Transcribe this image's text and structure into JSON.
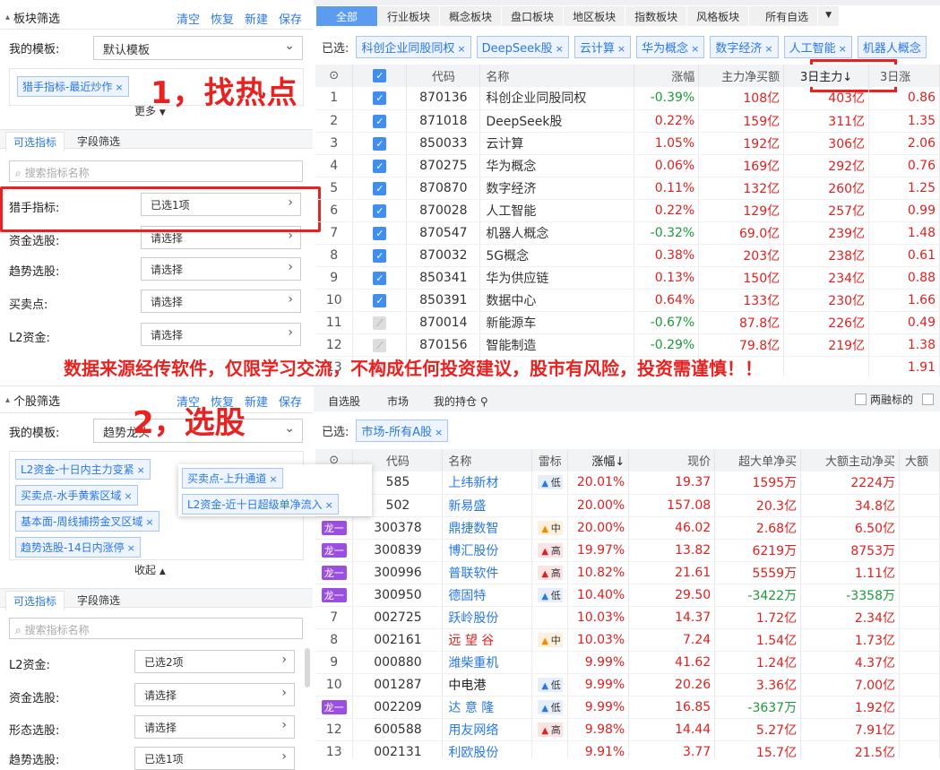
{
  "sector_filter": {
    "title": "板块筛选",
    "links": [
      "清空",
      "恢复",
      "新建",
      "保存"
    ],
    "template_label": "我的模板:",
    "template_value": "默认模板",
    "tag": "猎手指标-最近炒作",
    "more": "更多",
    "subtabs": [
      "可选指标",
      "字段筛选"
    ],
    "search_placeholder": "搜索指标名称",
    "rows": [
      {
        "label": "猎手指标:",
        "value": "已选1项"
      },
      {
        "label": "资金选股:",
        "value": "请选择"
      },
      {
        "label": "趋势选股:",
        "value": "请选择"
      },
      {
        "label": "买卖点:",
        "value": "请选择"
      },
      {
        "label": "L2资金:",
        "value": "请选择"
      }
    ]
  },
  "annotations": {
    "step1": "1，找热点",
    "step2": "2，选股",
    "disclaimer": "数据来源经传软件，仅限学习交流，不构成任何投资建议，股市有风险，投资需谨慎！！"
  },
  "sector_tabs": [
    "全部",
    "行业板块",
    "概念板块",
    "盘口板块",
    "地区板块",
    "指数板块",
    "风格板块",
    "所有自选"
  ],
  "sector_selected": {
    "label": "已选:",
    "chips": [
      "科创企业同股同权",
      "DeepSeek股",
      "云计算",
      "华为概念",
      "数字经济",
      "人工智能",
      "机器人概念"
    ]
  },
  "sector_table": {
    "headers": [
      "",
      "",
      "代码",
      "名称",
      "涨幅",
      "主力净买额",
      "3日主力↓",
      "3日涨"
    ],
    "rows": [
      {
        "n": "1",
        "checked": true,
        "code": "870136",
        "name": "科创企业同股同权",
        "chg": "-0.39%",
        "net": "108亿",
        "d3": "403亿",
        "d3c": "0.86"
      },
      {
        "n": "2",
        "checked": true,
        "code": "871018",
        "name": "DeepSeek股",
        "chg": "0.22%",
        "net": "159亿",
        "d3": "311亿",
        "d3c": "1.35"
      },
      {
        "n": "3",
        "checked": true,
        "code": "850033",
        "name": "云计算",
        "chg": "1.05%",
        "net": "192亿",
        "d3": "306亿",
        "d3c": "2.06"
      },
      {
        "n": "4",
        "checked": true,
        "code": "870275",
        "name": "华为概念",
        "chg": "0.06%",
        "net": "169亿",
        "d3": "292亿",
        "d3c": "0.76"
      },
      {
        "n": "5",
        "checked": true,
        "code": "870870",
        "name": "数字经济",
        "chg": "0.11%",
        "net": "132亿",
        "d3": "260亿",
        "d3c": "1.25"
      },
      {
        "n": "6",
        "checked": true,
        "code": "870028",
        "name": "人工智能",
        "chg": "0.22%",
        "net": "129亿",
        "d3": "257亿",
        "d3c": "0.99"
      },
      {
        "n": "7",
        "checked": true,
        "code": "870547",
        "name": "机器人概念",
        "chg": "-0.32%",
        "net": "69.0亿",
        "d3": "239亿",
        "d3c": "1.48"
      },
      {
        "n": "8",
        "checked": true,
        "code": "870032",
        "name": "5G概念",
        "chg": "0.38%",
        "net": "203亿",
        "d3": "238亿",
        "d3c": "0.61"
      },
      {
        "n": "9",
        "checked": true,
        "code": "850341",
        "name": "华为供应链",
        "chg": "0.13%",
        "net": "150亿",
        "d3": "234亿",
        "d3c": "0.88"
      },
      {
        "n": "10",
        "checked": true,
        "code": "850391",
        "name": "数据中心",
        "chg": "0.64%",
        "net": "133亿",
        "d3": "230亿",
        "d3c": "1.66"
      },
      {
        "n": "11",
        "checked": false,
        "code": "870014",
        "name": "新能源车",
        "chg": "-0.67%",
        "net": "87.8亿",
        "d3": "226亿",
        "d3c": "0.49"
      },
      {
        "n": "12",
        "checked": false,
        "code": "870156",
        "name": "智能制造",
        "chg": "-0.29%",
        "net": "79.8亿",
        "d3": "219亿",
        "d3c": "1.38"
      },
      {
        "n": "13",
        "checked": false,
        "code": "",
        "name": "",
        "chg": "",
        "net": "",
        "d3": "",
        "d3c": "1.91"
      }
    ]
  },
  "stock_filter": {
    "title": "个股筛选",
    "links": [
      "清空",
      "恢复",
      "新建",
      "保存"
    ],
    "template_label": "我的模板:",
    "template_value": "趋势龙头",
    "tags": [
      "L2资金-十日内主力变紧",
      "买卖点-水手黄紫区域",
      "基本面-周线捕捞金叉区域",
      "趋势选股-14日内涨停"
    ],
    "popup_tags": [
      "买卖点-上升通道",
      "L2资金-近十日超级单净流入"
    ],
    "collapse": "收起",
    "subtabs": [
      "可选指标",
      "字段筛选"
    ],
    "search_placeholder": "搜索指标名称",
    "rows": [
      {
        "label": "L2资金:",
        "value": "已选2项"
      },
      {
        "label": "资金选股:",
        "value": "请选择"
      },
      {
        "label": "形态选股:",
        "value": "请选择"
      },
      {
        "label": "趋势选股:",
        "value": "已选1项"
      }
    ]
  },
  "stock_tabs": [
    "自选股",
    "市场",
    "我的持仓"
  ],
  "stock_options": {
    "label": "两融标的"
  },
  "stock_selected": {
    "label": "已选:",
    "chips": [
      "市场-所有A股"
    ]
  },
  "stock_table": {
    "headers": [
      "",
      "代码",
      "名称",
      "雷标",
      "涨幅↓",
      "现价",
      "超大单净买",
      "大额主动净买",
      "大额"
    ],
    "rows": [
      {
        "n": "",
        "badge": "",
        "code": "585",
        "name": "上纬新材",
        "risk": "低",
        "chg": "20.01%",
        "price": "19.37",
        "big": "1595万",
        "act": "2224万"
      },
      {
        "n": "",
        "badge": "",
        "code": "502",
        "name": "新易盛",
        "risk": "",
        "chg": "20.00%",
        "price": "157.08",
        "big": "20.3亿",
        "act": "34.8亿"
      },
      {
        "n": "",
        "badge": "龙一",
        "code": "300378",
        "name": "鼎捷数智",
        "risk": "中",
        "chg": "20.00%",
        "price": "46.02",
        "big": "2.68亿",
        "act": "6.50亿"
      },
      {
        "n": "",
        "badge": "龙一",
        "code": "300839",
        "name": "博汇股份",
        "risk": "高",
        "chg": "19.97%",
        "price": "13.82",
        "big": "6219万",
        "act": "8753万"
      },
      {
        "n": "",
        "badge": "龙一",
        "code": "300996",
        "name": "普联软件",
        "risk": "高",
        "chg": "10.82%",
        "price": "21.61",
        "big": "5559万",
        "act": "1.11亿"
      },
      {
        "n": "",
        "badge": "龙一",
        "code": "300950",
        "name": "德固特",
        "risk": "低",
        "chg": "10.40%",
        "price": "29.50",
        "big": "-3422万",
        "act": "-3358万"
      },
      {
        "n": "7",
        "badge": "",
        "code": "002725",
        "name": "跃岭股份",
        "risk": "",
        "chg": "10.03%",
        "price": "14.37",
        "big": "1.72亿",
        "act": "2.34亿"
      },
      {
        "n": "8",
        "badge": "",
        "code": "002161",
        "name": "远 望 谷",
        "risk": "中",
        "chg": "10.03%",
        "price": "7.24",
        "big": "1.54亿",
        "act": "1.73亿"
      },
      {
        "n": "9",
        "badge": "",
        "code": "000880",
        "name": "潍柴重机",
        "risk": "",
        "chg": "9.99%",
        "price": "41.62",
        "big": "1.24亿",
        "act": "4.37亿"
      },
      {
        "n": "10",
        "badge": "",
        "code": "001287",
        "name": "中电港",
        "risk": "低",
        "chg": "9.99%",
        "price": "20.26",
        "big": "3.36亿",
        "act": "7.00亿"
      },
      {
        "n": "",
        "badge": "龙一",
        "code": "002209",
        "name": "达 意 隆",
        "risk": "低",
        "chg": "9.99%",
        "price": "16.85",
        "big": "-3637万",
        "act": "1.92亿"
      },
      {
        "n": "12",
        "badge": "",
        "code": "600588",
        "name": "用友网络",
        "risk": "高",
        "chg": "9.98%",
        "price": "14.44",
        "big": "5.27亿",
        "act": "7.91亿"
      },
      {
        "n": "13",
        "badge": "",
        "code": "002131",
        "name": "利欧股份",
        "risk": "",
        "chg": "9.91%",
        "price": "3.77",
        "big": "15.7亿",
        "act": "21.5亿"
      }
    ]
  },
  "colors": {
    "accent": "#2a78e4",
    "red": "#e02020",
    "green": "#1a9a3a",
    "highlight": "#e82121"
  }
}
